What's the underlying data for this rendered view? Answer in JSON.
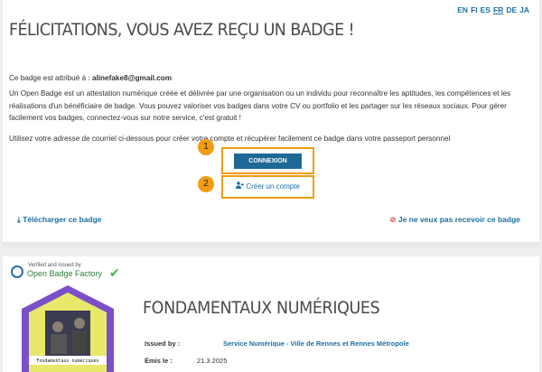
{
  "languages": [
    {
      "code": "EN",
      "current": false
    },
    {
      "code": "FI",
      "current": false
    },
    {
      "code": "ES",
      "current": false
    },
    {
      "code": "FR",
      "current": true
    },
    {
      "code": "DE",
      "current": false
    },
    {
      "code": "JA",
      "current": false
    }
  ],
  "page_title": "FÉLICITATIONS, VOUS AVEZ REÇU UN BADGE !",
  "intro": {
    "assigned_label": "Ce badge est attribué à : ",
    "assigned_email": "alinefake8@gmail.com",
    "description": "Un Open Badge est un attestation numérique créée et délivrée par une organisation ou un individu pour reconnaître les aptitudes, les compétences et les réalisations d'un bénéficiaire de badge. Vous pouvez valoriser vos badges dans votre CV ou portfolio et les partager sur les réseaux sociaux. Pour gérer facilement vos badges, connectez-vous sur notre service, c'est gratuit !",
    "instruction": "Utilisez votre adresse de courriel ci-dessous pour créer votre compte et récupérer facilement ce badge dans votre passeport personnel"
  },
  "annotations": {
    "mark1": "1",
    "mark2": "2",
    "color": "#f39c12"
  },
  "actions": {
    "connexion_label": "CONNEXION",
    "create_account_label": "Créer un compte",
    "download_label": "Télécharger ce badge",
    "decline_label": "Je ne veux pas recevoir ce badge"
  },
  "issuer_banner": {
    "verified_text": "Verified and issued by",
    "factory_name": "Open Badge Factory"
  },
  "badge": {
    "title": "FONDAMENTAUX NUMÉRIQUES",
    "image_caption": "Fondamentaux numériques",
    "issued_by_label": "Issued by :",
    "issued_by_value": "Service Numérique - Ville de Rennes et Rennes Métropole",
    "issued_on_label": "Émis le :",
    "issued_on_value": "21.3.2025"
  },
  "colors": {
    "accent": "#1b6ea4",
    "button": "#1e6896",
    "decline_icon": "#c0392b"
  }
}
